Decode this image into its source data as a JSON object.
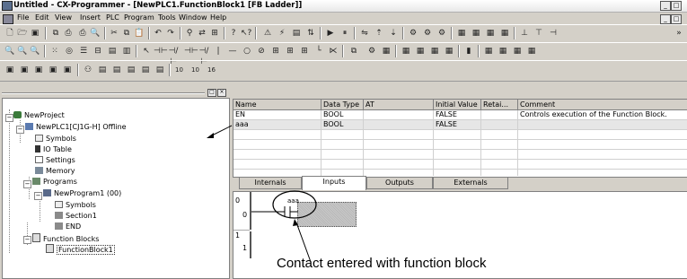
{
  "window": {
    "title": "Untitled - CX-Programmer - [NewPLC1.FunctionBlock1 [FB Ladder]]"
  },
  "menu": [
    "File",
    "Edit",
    "View",
    "Insert",
    "PLC",
    "Program",
    "Tools",
    "Window",
    "Help"
  ],
  "project_tree": {
    "root": "NewProject",
    "plc": "NewPLC1[CJ1G-H] Offline",
    "items": {
      "symbols": "Symbols",
      "io_table": "IO Table",
      "settings": "Settings",
      "memory": "Memory",
      "programs": "Programs",
      "program": "NewProgram1 (00)",
      "prog_symbols": "Symbols",
      "section": "Section1",
      "end": "END",
      "function_blocks": "Function Blocks",
      "function_block": "FunctionBlock1"
    }
  },
  "variable_table": {
    "headers": [
      "Name",
      "Data Type",
      "AT",
      "Initial Value",
      "Retai...",
      "Comment"
    ],
    "rows": [
      [
        "EN",
        "BOOL",
        "",
        "FALSE",
        "",
        "Controls execution of the Function Block."
      ],
      [
        "aaa",
        "BOOL",
        "",
        "FALSE",
        "",
        ""
      ]
    ]
  },
  "tabs": {
    "internals": "Internals",
    "inputs": "Inputs",
    "outputs": "Outputs",
    "externals": "Externals",
    "active": "Inputs"
  },
  "ladder": {
    "rungs": [
      {
        "number": "0",
        "step": "0"
      },
      {
        "number": "1",
        "step": "1"
      }
    ],
    "contact_label": "aaa"
  },
  "annotation": "Contact entered with function block"
}
